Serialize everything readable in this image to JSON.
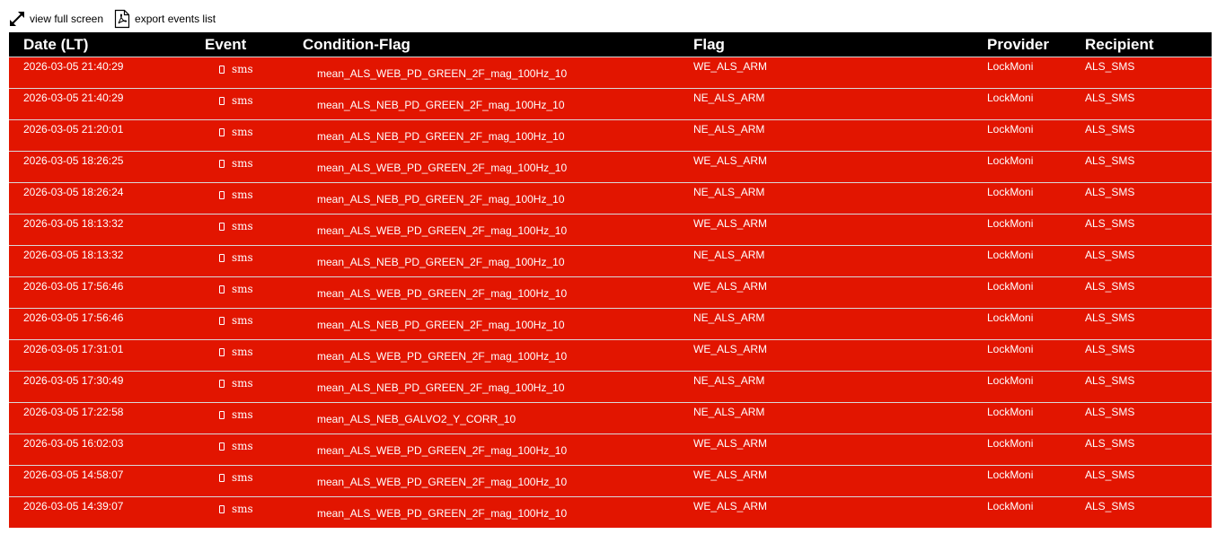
{
  "toolbar": {
    "fullscreen": {
      "icon": "expand-arrows-icon",
      "label": "view full screen"
    },
    "export": {
      "icon": "pdf-file-icon",
      "label": "export events list"
    }
  },
  "table": {
    "headers": [
      "Date (LT)",
      "Event",
      "Condition-Flag",
      "Flag",
      "Provider",
      "Recipient"
    ],
    "rows": [
      {
        "date": "2026-03-05 21:40:29",
        "event": "sms",
        "condition": "mean_ALS_WEB_PD_GREEN_2F_mag_100Hz_10",
        "flag": "WE_ALS_ARM",
        "provider": "LockMoni",
        "recipient": "ALS_SMS"
      },
      {
        "date": "2026-03-05 21:40:29",
        "event": "sms",
        "condition": "mean_ALS_NEB_PD_GREEN_2F_mag_100Hz_10",
        "flag": "NE_ALS_ARM",
        "provider": "LockMoni",
        "recipient": "ALS_SMS"
      },
      {
        "date": "2026-03-05 21:20:01",
        "event": "sms",
        "condition": "mean_ALS_NEB_PD_GREEN_2F_mag_100Hz_10",
        "flag": "NE_ALS_ARM",
        "provider": "LockMoni",
        "recipient": "ALS_SMS"
      },
      {
        "date": "2026-03-05 18:26:25",
        "event": "sms",
        "condition": "mean_ALS_WEB_PD_GREEN_2F_mag_100Hz_10",
        "flag": "WE_ALS_ARM",
        "provider": "LockMoni",
        "recipient": "ALS_SMS"
      },
      {
        "date": "2026-03-05 18:26:24",
        "event": "sms",
        "condition": "mean_ALS_NEB_PD_GREEN_2F_mag_100Hz_10",
        "flag": "NE_ALS_ARM",
        "provider": "LockMoni",
        "recipient": "ALS_SMS"
      },
      {
        "date": "2026-03-05 18:13:32",
        "event": "sms",
        "condition": "mean_ALS_WEB_PD_GREEN_2F_mag_100Hz_10",
        "flag": "WE_ALS_ARM",
        "provider": "LockMoni",
        "recipient": "ALS_SMS"
      },
      {
        "date": "2026-03-05 18:13:32",
        "event": "sms",
        "condition": "mean_ALS_NEB_PD_GREEN_2F_mag_100Hz_10",
        "flag": "NE_ALS_ARM",
        "provider": "LockMoni",
        "recipient": "ALS_SMS"
      },
      {
        "date": "2026-03-05 17:56:46",
        "event": "sms",
        "condition": "mean_ALS_WEB_PD_GREEN_2F_mag_100Hz_10",
        "flag": "WE_ALS_ARM",
        "provider": "LockMoni",
        "recipient": "ALS_SMS"
      },
      {
        "date": "2026-03-05 17:56:46",
        "event": "sms",
        "condition": "mean_ALS_NEB_PD_GREEN_2F_mag_100Hz_10",
        "flag": "NE_ALS_ARM",
        "provider": "LockMoni",
        "recipient": "ALS_SMS"
      },
      {
        "date": "2026-03-05 17:31:01",
        "event": "sms",
        "condition": "mean_ALS_WEB_PD_GREEN_2F_mag_100Hz_10",
        "flag": "WE_ALS_ARM",
        "provider": "LockMoni",
        "recipient": "ALS_SMS"
      },
      {
        "date": "2026-03-05 17:30:49",
        "event": "sms",
        "condition": "mean_ALS_NEB_PD_GREEN_2F_mag_100Hz_10",
        "flag": "NE_ALS_ARM",
        "provider": "LockMoni",
        "recipient": "ALS_SMS"
      },
      {
        "date": "2026-03-05 17:22:58",
        "event": "sms",
        "condition": "mean_ALS_NEB_GALVO2_Y_CORR_10",
        "flag": "NE_ALS_ARM",
        "provider": "LockMoni",
        "recipient": "ALS_SMS"
      },
      {
        "date": "2026-03-05 16:02:03",
        "event": "sms",
        "condition": "mean_ALS_WEB_PD_GREEN_2F_mag_100Hz_10",
        "flag": "WE_ALS_ARM",
        "provider": "LockMoni",
        "recipient": "ALS_SMS"
      },
      {
        "date": "2026-03-05 14:58:07",
        "event": "sms",
        "condition": "mean_ALS_WEB_PD_GREEN_2F_mag_100Hz_10",
        "flag": "WE_ALS_ARM",
        "provider": "LockMoni",
        "recipient": "ALS_SMS"
      },
      {
        "date": "2026-03-05 14:39:07",
        "event": "sms",
        "condition": "mean_ALS_WEB_PD_GREEN_2F_mag_100Hz_10",
        "flag": "WE_ALS_ARM",
        "provider": "LockMoni",
        "recipient": "ALS_SMS"
      }
    ]
  },
  "colors": {
    "header_bg": "#000000",
    "row_bg": "#e21500",
    "row_divider": "#d9d9d9",
    "text": "#ffffff"
  },
  "icons": {
    "event": "mobile-phone-icon"
  }
}
